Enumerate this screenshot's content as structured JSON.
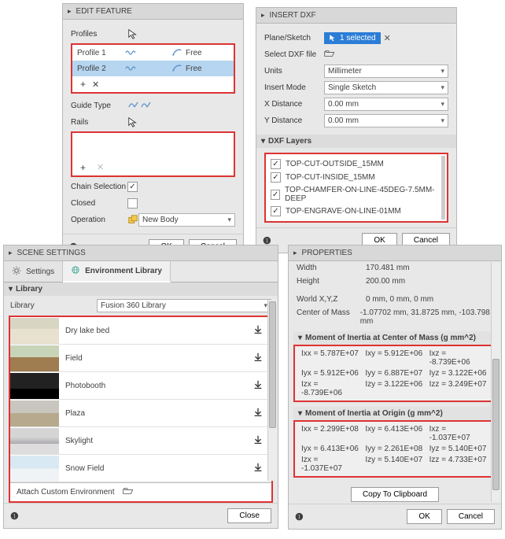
{
  "editFeature": {
    "title": "EDIT FEATURE",
    "profilesLabel": "Profiles",
    "profiles": [
      {
        "name": "Profile 1",
        "mode": "Free"
      },
      {
        "name": "Profile 2",
        "mode": "Free"
      }
    ],
    "guideTypeLabel": "Guide Type",
    "railsLabel": "Rails",
    "chainLabel": "Chain Selection",
    "chainChecked": true,
    "closedLabel": "Closed",
    "closedChecked": false,
    "operationLabel": "Operation",
    "operationValue": "New Body",
    "ok": "OK",
    "cancel": "Cancel"
  },
  "insertDxf": {
    "title": "INSERT DXF",
    "planeLabel": "Plane/Sketch",
    "planeSelected": "1 selected",
    "fileLabel": "Select DXF file",
    "unitsLabel": "Units",
    "unitsValue": "Millimeter",
    "modeLabel": "Insert Mode",
    "modeValue": "Single Sketch",
    "xLabel": "X Distance",
    "xValue": "0.00 mm",
    "yLabel": "Y Distance",
    "yValue": "0.00 mm",
    "layersTitle": "DXF Layers",
    "layers": [
      "TOP-CUT-OUTSIDE_15MM",
      "TOP-CUT-INSIDE_15MM",
      "TOP-CHAMFER-ON-LINE-45DEG-7.5MM-DEEP",
      "TOP-ENGRAVE-ON-LINE-01MM"
    ],
    "ok": "OK",
    "cancel": "Cancel"
  },
  "scene": {
    "title": "SCENE SETTINGS",
    "tabSettings": "Settings",
    "tabEnv": "Environment Library",
    "libHeader": "Library",
    "libLabel": "Library",
    "libValue": "Fusion 360 Library",
    "environments": [
      "Dry lake bed",
      "Field",
      "Photobooth",
      "Plaza",
      "Skylight",
      "Snow Field"
    ],
    "attachLabel": "Attach Custom Environment",
    "close": "Close"
  },
  "props": {
    "title": "PROPERTIES",
    "widthLabel": "Width",
    "widthValue": "170.481 mm",
    "heightLabel": "Height",
    "heightValue": "200.00 mm",
    "worldLabel": "World X,Y,Z",
    "worldValue": "0 mm, 0 mm, 0 mm",
    "comLabel": "Center of Mass",
    "comValue": "-1.07702 mm, 31.8725 mm, -103.798 mm",
    "moiComTitle": "Moment of Inertia at Center of Mass   (g mm^2)",
    "moiCom": {
      "ixx": "Ixx = 5.787E+07",
      "ixy": "Ixy = 5.912E+06",
      "ixz": "Ixz = -8.739E+06",
      "iyx": "Iyx = 5.912E+06",
      "iyy": "Iyy = 6.887E+07",
      "iyz": "Iyz = 3.122E+06",
      "izx": "Izx = -8.739E+06",
      "izy": "Izy = 3.122E+06",
      "izz": "Izz = 3.249E+07"
    },
    "moiOriginTitle": "Moment of Inertia at Origin   (g mm^2)",
    "moiOrigin": {
      "ixx": "Ixx = 2.299E+08",
      "ixy": "Ixy = 6.413E+06",
      "ixz": "Ixz = -1.037E+07",
      "iyx": "Iyx = 6.413E+06",
      "iyy": "Iyy = 2.261E+08",
      "iyz": "Iyz = 5.140E+07",
      "izx": "Izx = -1.037E+07",
      "izy": "Izy = 5.140E+07",
      "izz": "Izz = 4.733E+07"
    },
    "copy": "Copy To Clipboard",
    "ok": "OK",
    "cancel": "Cancel"
  }
}
